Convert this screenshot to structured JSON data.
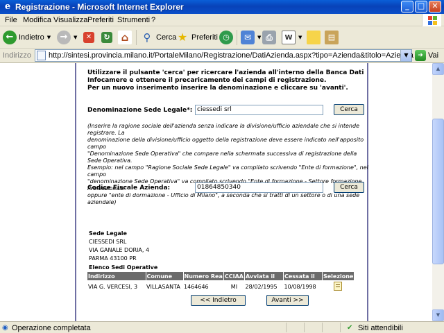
{
  "window": {
    "title": "Registrazione - Microsoft Internet Explorer",
    "minimize_glyph": "_",
    "maximize_glyph": "□",
    "close_glyph": "✕"
  },
  "menu": [
    "File",
    "Modifica",
    "Visualizza",
    "Preferiti",
    "Strumenti",
    "?"
  ],
  "toolbar": {
    "back_label": "Indietro",
    "search_label": "Cerca",
    "favorites_label": "Preferiti"
  },
  "address": {
    "label": "Indirizzo",
    "url": "http://sintesi.provincia.milano.it/PortaleMilano/Registrazione/DatiAzienda.aspx?tipo=Azienda&titolo=Azienda",
    "go_label": "Vai"
  },
  "page": {
    "intro_lines": [
      "Utilizzare il pulsante 'cerca' per ricercare l'azienda all'interno della Banca Dati",
      "Infocamere e ottenere il precaricamento dei campi di registrazione.",
      "Per un nuovo inserimento inserire la denominazione e cliccare su 'avanti'."
    ],
    "denominazione_label": "Denominazione Sede Legale*:",
    "denominazione_value": "ciessedi srl",
    "cerca_label": "Cerca",
    "note_lines": [
      "(Inserire la ragione sociale dell'azienda senza indicare la divisione/ufficio aziendale che si intende registrare. La",
      "denominazione della divisione/ufficio oggetto della registrazione deve essere indicato nell'apposito campo",
      "\"Denominazione Sede Operativa\" che compare nella schermata successiva di registrazione della Sede Operativa.",
      "Esempio: nel campo \"Ragione Sociale Sede Legale\" va compilato scrivendo \"Ente di formazione\", nel campo",
      "\"denominazione Sede Operativa\" va compilato scrivendo \"Ente di formazione - Settore formazione Professionale\"",
      "oppure \"ente di dormazione - Ufficio di Milano\", a seconda che si tratti di un settore o di una sede aziendale)"
    ],
    "codice_label": "Codice Fiscale Azienda:",
    "codice_value": "01864850340",
    "cerca2_label": "Cerca",
    "sede_legale_title": "Sede Legale",
    "sede_lines": [
      "CIESSEDI SRL",
      "VIA GANALE DORIA, 4",
      "PARMA  43100 PR"
    ],
    "elenco_title": "Elenco Sedi Operative",
    "table_headers": [
      "Indirizzo",
      "Comune",
      "Numero Rea",
      "CCIAA",
      "Avviata il",
      "Cessata il",
      "Selezione"
    ],
    "table_rows": [
      [
        "VIA G. VERCESI, 3",
        "VILLASANTA",
        "1464646",
        "MI",
        "28/02/1995",
        "10/08/1998"
      ]
    ],
    "back_button": "<< Indietro",
    "next_button": "Avanti >>"
  },
  "status": {
    "left": "Operazione completata",
    "right": "Siti attendibili"
  },
  "colors": {
    "titlebar": "#0a4fc9",
    "table_header": "#6b6b6b",
    "column_border": "#6f6fa3"
  }
}
